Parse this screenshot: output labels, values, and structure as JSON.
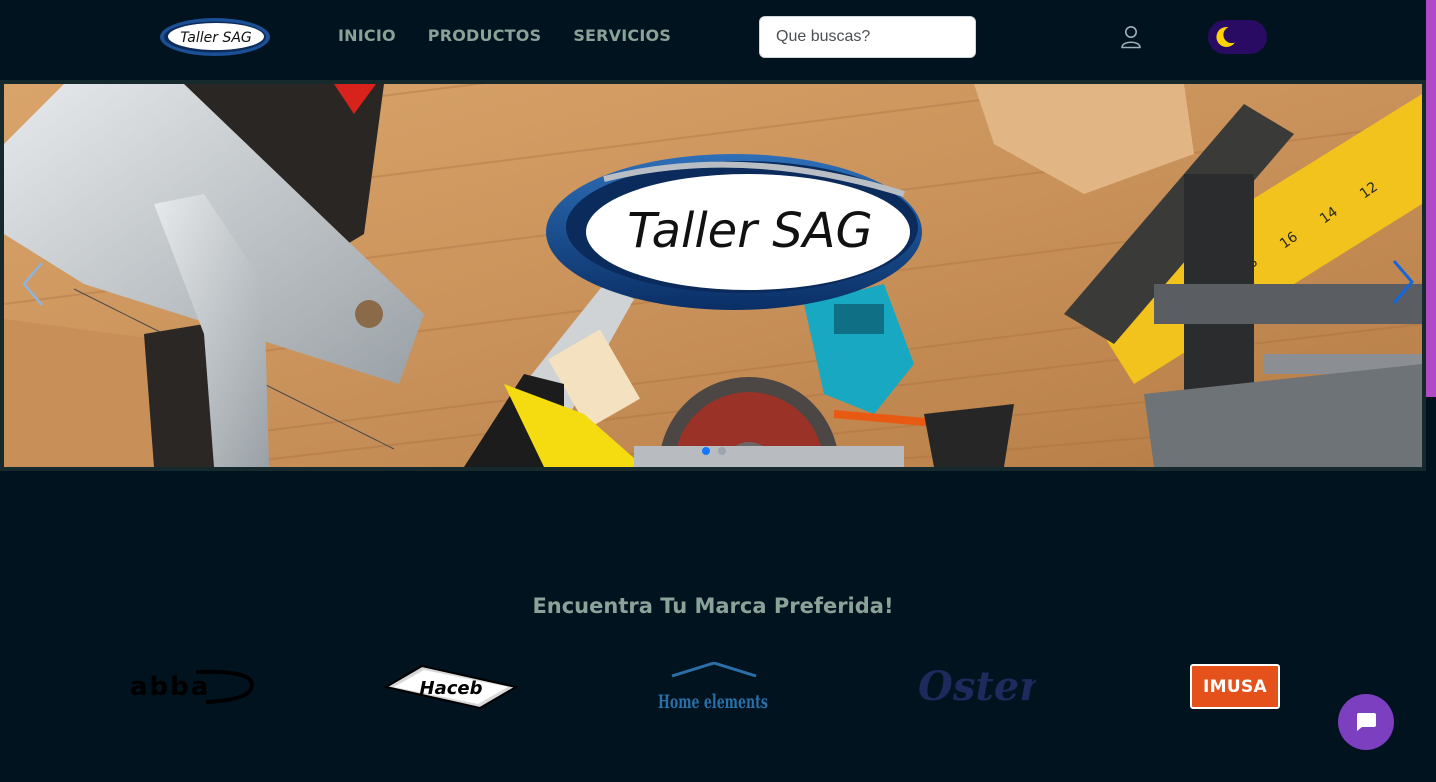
{
  "header": {
    "logo_text": "Taller SAG",
    "nav": [
      "INICIO",
      "PRODUCTOS",
      "SERVICIOS"
    ],
    "search_placeholder": "Que buscas?"
  },
  "hero": {
    "logo_text": "Taller SAG",
    "slide_count": 2,
    "active_slide": 1
  },
  "brands": {
    "title": "Encuentra Tu Marca Preferida!",
    "items": [
      "abba",
      "Haceb",
      "Home elements",
      "Oster",
      "IMUSA"
    ]
  },
  "colors": {
    "background": "#01131e",
    "nav_text": "#8aa398",
    "toggle_bg": "#2a0b63",
    "moon": "#ffd400",
    "scroll_thumb": "#b14ac7",
    "chat_button": "#7b3fc0",
    "carousel_active_dot": "#1478ff",
    "imusa_orange": "#e5511b"
  },
  "icons": {
    "user": "user-icon",
    "theme": "moon-icon",
    "prev": "chevron-left-icon",
    "next": "chevron-right-icon",
    "chat": "chat-icon"
  }
}
